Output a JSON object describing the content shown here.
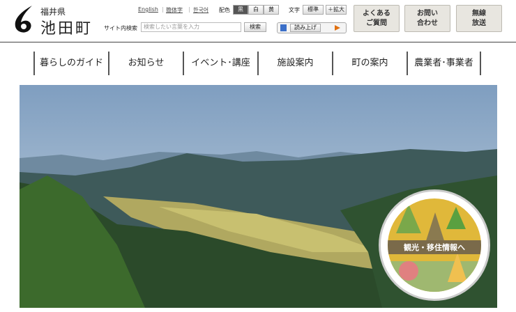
{
  "logo": {
    "prefecture": "福井県",
    "town": "池田町"
  },
  "header": {
    "languages": [
      "English",
      "簡体字",
      "한국어"
    ],
    "color_label": "配色",
    "colors": [
      "黒",
      "白",
      "黄"
    ],
    "text_label": "文字",
    "text_sizes": [
      "標準",
      "＋拡大"
    ],
    "search_label": "サイト内検索",
    "search_placeholder": "検索したい言葉を入力",
    "search_button": "検索",
    "read_aloud": "読み上げ",
    "quick": [
      [
        "よくある",
        "ご質問"
      ],
      [
        "お問い",
        "合わせ"
      ],
      [
        "無線",
        "放送"
      ]
    ]
  },
  "nav": [
    "暮らしのガイド",
    "お知らせ",
    "イベント･講座",
    "施設案内",
    "町の案内",
    "農業者･事業者"
  ],
  "hero": {
    "badge": "観光・移住情報へ"
  }
}
